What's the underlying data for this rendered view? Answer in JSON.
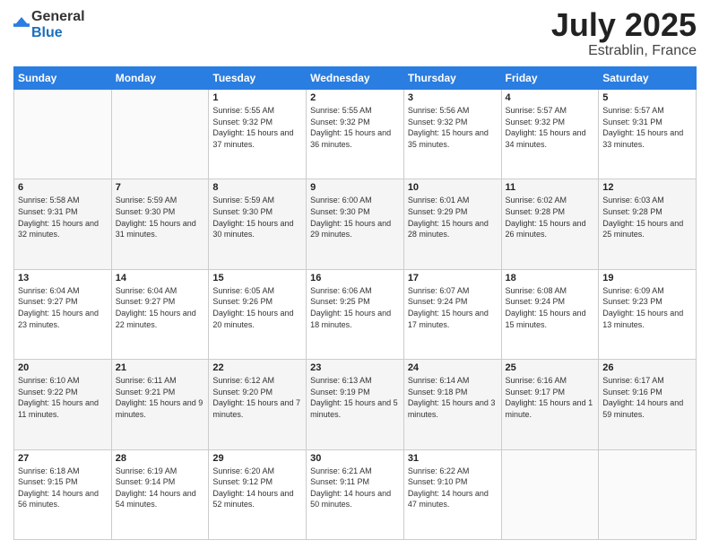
{
  "logo": {
    "general": "General",
    "blue": "Blue"
  },
  "header": {
    "month": "July 2025",
    "location": "Estrablin, France"
  },
  "weekdays": [
    "Sunday",
    "Monday",
    "Tuesday",
    "Wednesday",
    "Thursday",
    "Friday",
    "Saturday"
  ],
  "weeks": [
    [
      {
        "day": "",
        "sunrise": "",
        "sunset": "",
        "daylight": ""
      },
      {
        "day": "",
        "sunrise": "",
        "sunset": "",
        "daylight": ""
      },
      {
        "day": "1",
        "sunrise": "Sunrise: 5:55 AM",
        "sunset": "Sunset: 9:32 PM",
        "daylight": "Daylight: 15 hours and 37 minutes."
      },
      {
        "day": "2",
        "sunrise": "Sunrise: 5:55 AM",
        "sunset": "Sunset: 9:32 PM",
        "daylight": "Daylight: 15 hours and 36 minutes."
      },
      {
        "day": "3",
        "sunrise": "Sunrise: 5:56 AM",
        "sunset": "Sunset: 9:32 PM",
        "daylight": "Daylight: 15 hours and 35 minutes."
      },
      {
        "day": "4",
        "sunrise": "Sunrise: 5:57 AM",
        "sunset": "Sunset: 9:32 PM",
        "daylight": "Daylight: 15 hours and 34 minutes."
      },
      {
        "day": "5",
        "sunrise": "Sunrise: 5:57 AM",
        "sunset": "Sunset: 9:31 PM",
        "daylight": "Daylight: 15 hours and 33 minutes."
      }
    ],
    [
      {
        "day": "6",
        "sunrise": "Sunrise: 5:58 AM",
        "sunset": "Sunset: 9:31 PM",
        "daylight": "Daylight: 15 hours and 32 minutes."
      },
      {
        "day": "7",
        "sunrise": "Sunrise: 5:59 AM",
        "sunset": "Sunset: 9:30 PM",
        "daylight": "Daylight: 15 hours and 31 minutes."
      },
      {
        "day": "8",
        "sunrise": "Sunrise: 5:59 AM",
        "sunset": "Sunset: 9:30 PM",
        "daylight": "Daylight: 15 hours and 30 minutes."
      },
      {
        "day": "9",
        "sunrise": "Sunrise: 6:00 AM",
        "sunset": "Sunset: 9:30 PM",
        "daylight": "Daylight: 15 hours and 29 minutes."
      },
      {
        "day": "10",
        "sunrise": "Sunrise: 6:01 AM",
        "sunset": "Sunset: 9:29 PM",
        "daylight": "Daylight: 15 hours and 28 minutes."
      },
      {
        "day": "11",
        "sunrise": "Sunrise: 6:02 AM",
        "sunset": "Sunset: 9:28 PM",
        "daylight": "Daylight: 15 hours and 26 minutes."
      },
      {
        "day": "12",
        "sunrise": "Sunrise: 6:03 AM",
        "sunset": "Sunset: 9:28 PM",
        "daylight": "Daylight: 15 hours and 25 minutes."
      }
    ],
    [
      {
        "day": "13",
        "sunrise": "Sunrise: 6:04 AM",
        "sunset": "Sunset: 9:27 PM",
        "daylight": "Daylight: 15 hours and 23 minutes."
      },
      {
        "day": "14",
        "sunrise": "Sunrise: 6:04 AM",
        "sunset": "Sunset: 9:27 PM",
        "daylight": "Daylight: 15 hours and 22 minutes."
      },
      {
        "day": "15",
        "sunrise": "Sunrise: 6:05 AM",
        "sunset": "Sunset: 9:26 PM",
        "daylight": "Daylight: 15 hours and 20 minutes."
      },
      {
        "day": "16",
        "sunrise": "Sunrise: 6:06 AM",
        "sunset": "Sunset: 9:25 PM",
        "daylight": "Daylight: 15 hours and 18 minutes."
      },
      {
        "day": "17",
        "sunrise": "Sunrise: 6:07 AM",
        "sunset": "Sunset: 9:24 PM",
        "daylight": "Daylight: 15 hours and 17 minutes."
      },
      {
        "day": "18",
        "sunrise": "Sunrise: 6:08 AM",
        "sunset": "Sunset: 9:24 PM",
        "daylight": "Daylight: 15 hours and 15 minutes."
      },
      {
        "day": "19",
        "sunrise": "Sunrise: 6:09 AM",
        "sunset": "Sunset: 9:23 PM",
        "daylight": "Daylight: 15 hours and 13 minutes."
      }
    ],
    [
      {
        "day": "20",
        "sunrise": "Sunrise: 6:10 AM",
        "sunset": "Sunset: 9:22 PM",
        "daylight": "Daylight: 15 hours and 11 minutes."
      },
      {
        "day": "21",
        "sunrise": "Sunrise: 6:11 AM",
        "sunset": "Sunset: 9:21 PM",
        "daylight": "Daylight: 15 hours and 9 minutes."
      },
      {
        "day": "22",
        "sunrise": "Sunrise: 6:12 AM",
        "sunset": "Sunset: 9:20 PM",
        "daylight": "Daylight: 15 hours and 7 minutes."
      },
      {
        "day": "23",
        "sunrise": "Sunrise: 6:13 AM",
        "sunset": "Sunset: 9:19 PM",
        "daylight": "Daylight: 15 hours and 5 minutes."
      },
      {
        "day": "24",
        "sunrise": "Sunrise: 6:14 AM",
        "sunset": "Sunset: 9:18 PM",
        "daylight": "Daylight: 15 hours and 3 minutes."
      },
      {
        "day": "25",
        "sunrise": "Sunrise: 6:16 AM",
        "sunset": "Sunset: 9:17 PM",
        "daylight": "Daylight: 15 hours and 1 minute."
      },
      {
        "day": "26",
        "sunrise": "Sunrise: 6:17 AM",
        "sunset": "Sunset: 9:16 PM",
        "daylight": "Daylight: 14 hours and 59 minutes."
      }
    ],
    [
      {
        "day": "27",
        "sunrise": "Sunrise: 6:18 AM",
        "sunset": "Sunset: 9:15 PM",
        "daylight": "Daylight: 14 hours and 56 minutes."
      },
      {
        "day": "28",
        "sunrise": "Sunrise: 6:19 AM",
        "sunset": "Sunset: 9:14 PM",
        "daylight": "Daylight: 14 hours and 54 minutes."
      },
      {
        "day": "29",
        "sunrise": "Sunrise: 6:20 AM",
        "sunset": "Sunset: 9:12 PM",
        "daylight": "Daylight: 14 hours and 52 minutes."
      },
      {
        "day": "30",
        "sunrise": "Sunrise: 6:21 AM",
        "sunset": "Sunset: 9:11 PM",
        "daylight": "Daylight: 14 hours and 50 minutes."
      },
      {
        "day": "31",
        "sunrise": "Sunrise: 6:22 AM",
        "sunset": "Sunset: 9:10 PM",
        "daylight": "Daylight: 14 hours and 47 minutes."
      },
      {
        "day": "",
        "sunrise": "",
        "sunset": "",
        "daylight": ""
      },
      {
        "day": "",
        "sunrise": "",
        "sunset": "",
        "daylight": ""
      }
    ]
  ]
}
